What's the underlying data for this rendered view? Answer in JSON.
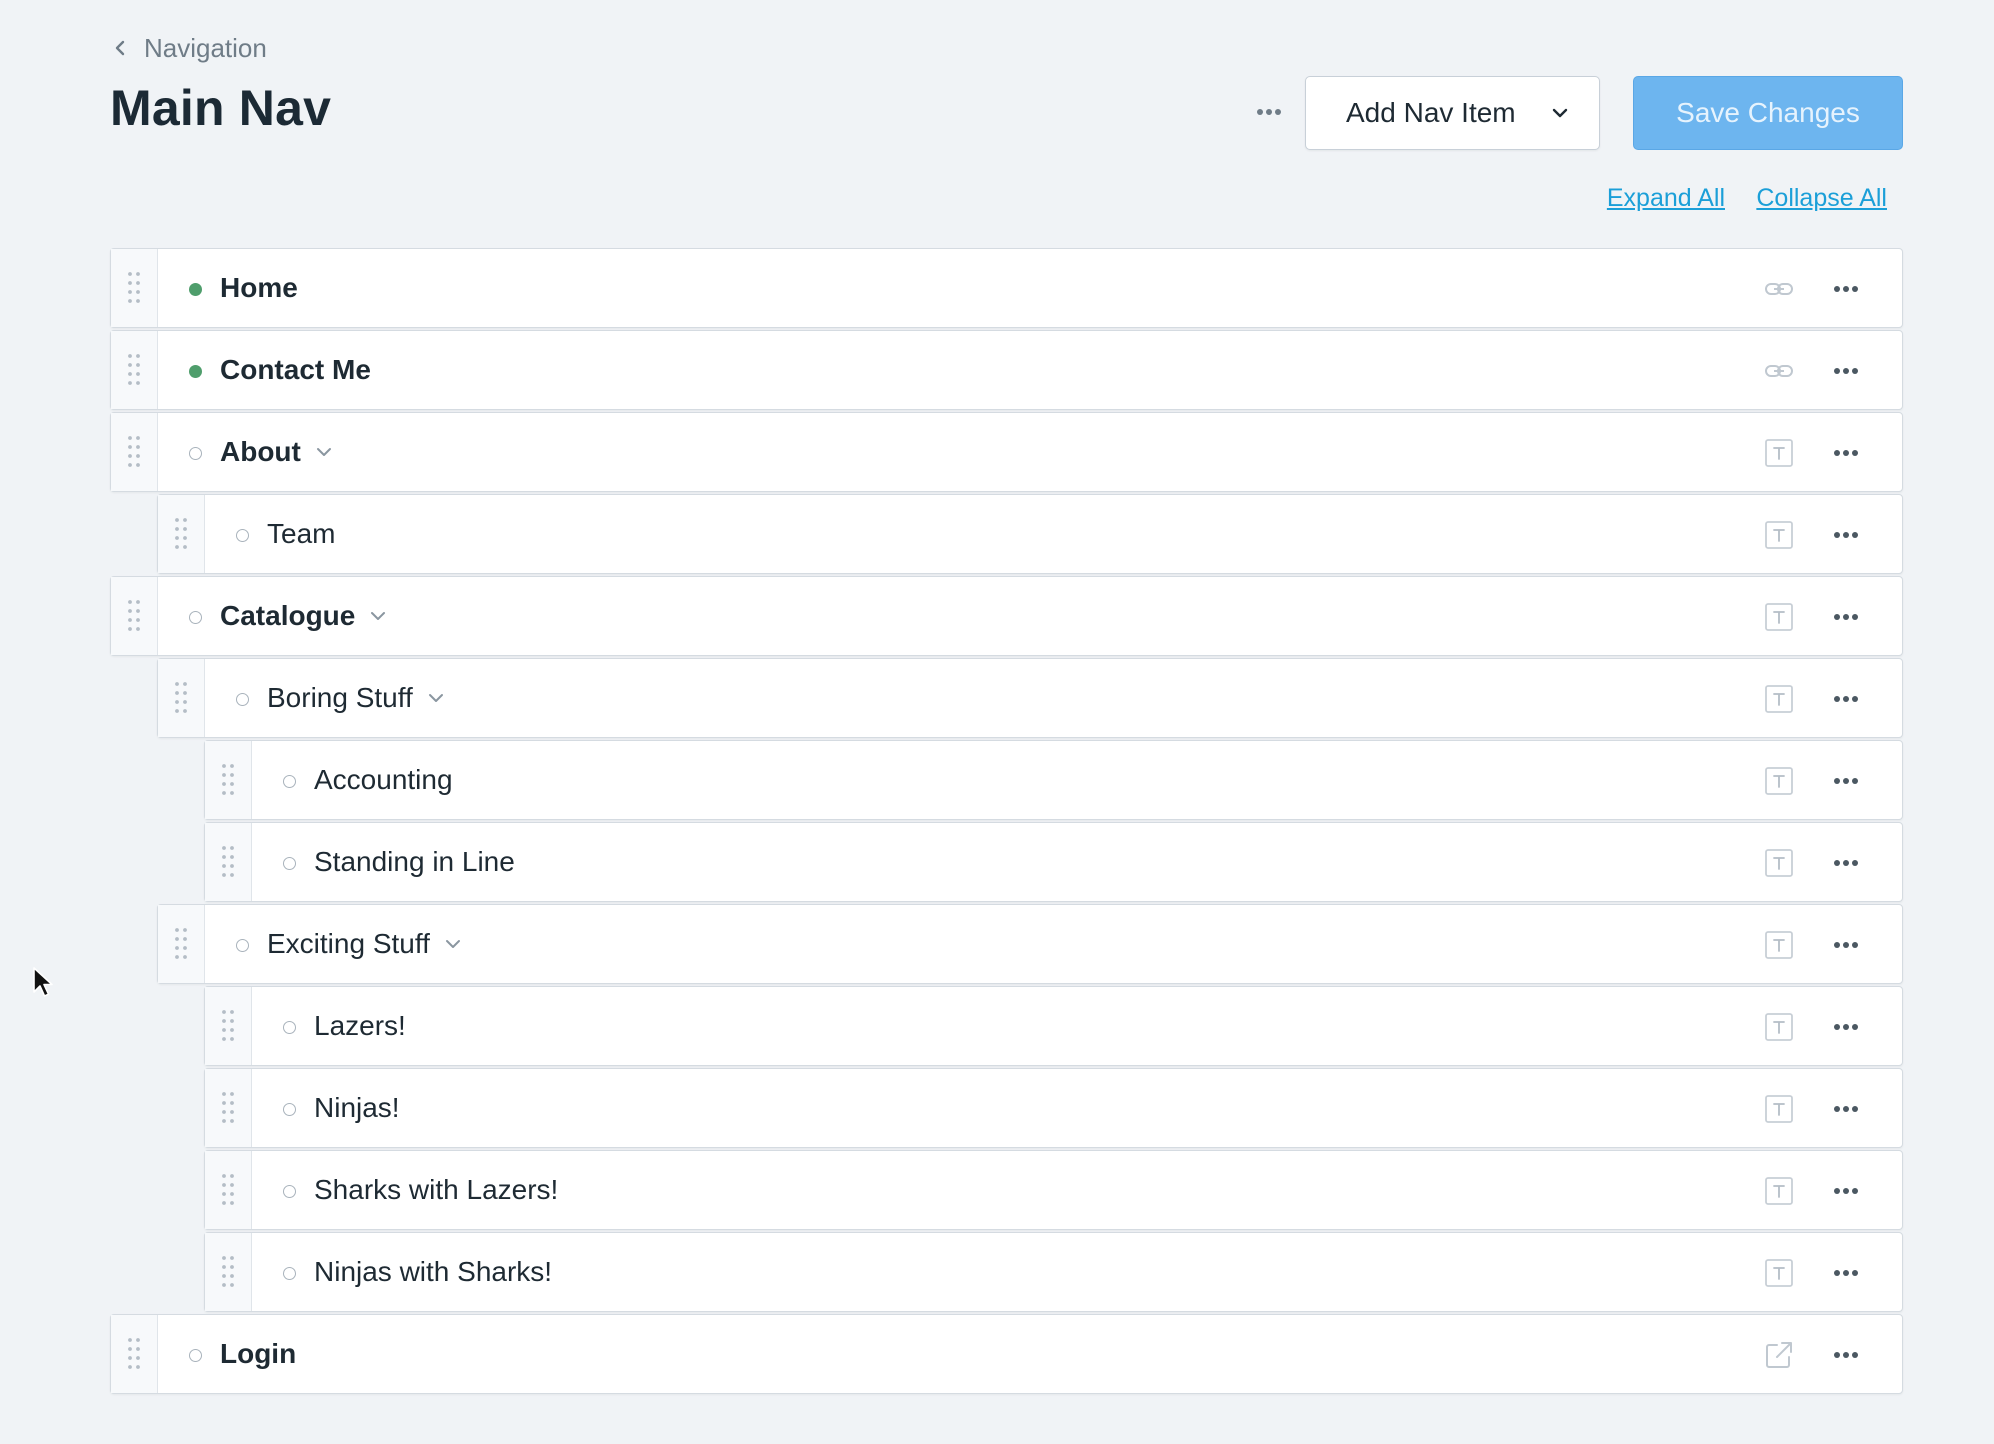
{
  "breadcrumb": {
    "label": "Navigation"
  },
  "header": {
    "title": "Main Nav",
    "add_button_label": "Add Nav Item",
    "save_button_label": "Save Changes"
  },
  "actions": {
    "expand_all": "Expand All",
    "collapse_all": "Collapse All"
  },
  "colors": {
    "accent": "#1b9fd8",
    "save_disabled": "#6db5ef",
    "published": "#4f9e6c",
    "background": "#f0f3f6"
  },
  "tree": [
    {
      "label": "Home",
      "depth": 0,
      "published": true,
      "expandable": false,
      "type_icon": "link-icon"
    },
    {
      "label": "Contact Me",
      "depth": 0,
      "published": true,
      "expandable": false,
      "type_icon": "link-icon"
    },
    {
      "label": "About",
      "depth": 0,
      "published": false,
      "expandable": true,
      "type_icon": "text-entry-icon"
    },
    {
      "label": "Team",
      "depth": 1,
      "published": false,
      "expandable": false,
      "type_icon": "text-entry-icon"
    },
    {
      "label": "Catalogue",
      "depth": 0,
      "published": false,
      "expandable": true,
      "type_icon": "text-entry-icon"
    },
    {
      "label": "Boring Stuff",
      "depth": 1,
      "published": false,
      "expandable": true,
      "type_icon": "text-entry-icon"
    },
    {
      "label": "Accounting",
      "depth": 2,
      "published": false,
      "expandable": false,
      "type_icon": "text-entry-icon"
    },
    {
      "label": "Standing in Line",
      "depth": 2,
      "published": false,
      "expandable": false,
      "type_icon": "text-entry-icon"
    },
    {
      "label": "Exciting Stuff",
      "depth": 1,
      "published": false,
      "expandable": true,
      "type_icon": "text-entry-icon"
    },
    {
      "label": "Lazers!",
      "depth": 2,
      "published": false,
      "expandable": false,
      "type_icon": "text-entry-icon"
    },
    {
      "label": "Ninjas!",
      "depth": 2,
      "published": false,
      "expandable": false,
      "type_icon": "text-entry-icon"
    },
    {
      "label": "Sharks with Lazers!",
      "depth": 2,
      "published": false,
      "expandable": false,
      "type_icon": "text-entry-icon"
    },
    {
      "label": "Ninjas with Sharks!",
      "depth": 2,
      "published": false,
      "expandable": false,
      "type_icon": "text-entry-icon"
    },
    {
      "label": "Login",
      "depth": 0,
      "published": false,
      "expandable": false,
      "type_icon": "external-link-icon"
    }
  ]
}
